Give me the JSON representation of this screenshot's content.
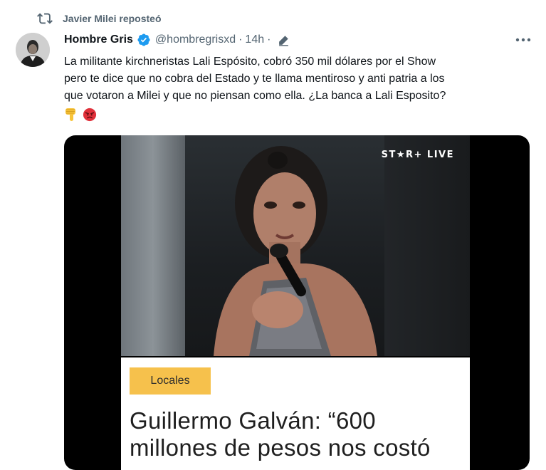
{
  "repost": {
    "label": "Javier Milei reposteó",
    "icon": "repost-icon"
  },
  "tweet": {
    "author_name": "Hombre Gris",
    "handle": "@hombregrisxd",
    "separator": "·",
    "time": "14h",
    "separator2": "·",
    "text_lines": [
      "La militante kirchneristas Lali Espósito,  cobró 350 mil dólares por el Show",
      "pero te dice que no cobra del Estado y te llama mentiroso y anti patria a los",
      "que votaron a Milei y que no piensan como ella. ¿La banca a Lali Esposito?"
    ],
    "emojis": [
      "thumbs-down-emoji",
      "angry-face-emoji"
    ]
  },
  "media": {
    "video_logo": "ST★R+ LIVE",
    "article_category": "Locales",
    "headline_lines": [
      "Guillermo Galván: “600",
      "millones de pesos nos costó"
    ]
  },
  "colors": {
    "verified": "#1d9bf0",
    "badge": "#f6c14c",
    "secondary_text": "#536471"
  }
}
